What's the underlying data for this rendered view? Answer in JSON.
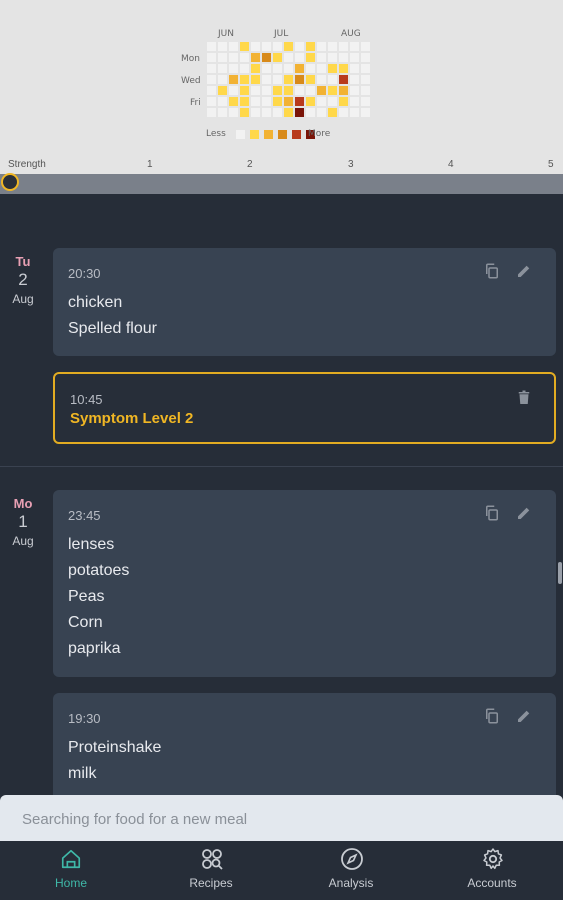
{
  "heatmap": {
    "months": [
      "JUN",
      "JUL",
      "AUG"
    ],
    "days": [
      "Mon",
      "Wed",
      "Fri"
    ],
    "legend_less": "Less",
    "legend_more": "More",
    "colors": {
      "empty": "#f2f2f2",
      "l1": "#ffd84a",
      "l2": "#f2b233",
      "l3": "#d88a1a",
      "l4": "#b83a1c",
      "l5": "#7a1408"
    }
  },
  "strength": {
    "label": "Strength",
    "ticks": [
      "1",
      "2",
      "3",
      "4",
      "5"
    ],
    "value": 0
  },
  "days": [
    {
      "dow": "Tu",
      "num": "2",
      "month": "Aug",
      "meals": [
        {
          "time": "20:30",
          "items": [
            "chicken",
            "Spelled flour"
          ]
        }
      ],
      "symptom": {
        "time": "10:45",
        "title": "Symptom Level 2"
      }
    },
    {
      "dow": "Mo",
      "num": "1",
      "month": "Aug",
      "meals": [
        {
          "time": "23:45",
          "items": [
            "lenses",
            "potatoes",
            "Peas",
            "Corn",
            "paprika"
          ]
        },
        {
          "time": "19:30",
          "items": [
            "Proteinshake",
            "milk"
          ]
        }
      ]
    }
  ],
  "search": {
    "placeholder": "Searching for food for a new meal"
  },
  "nav": [
    {
      "label": "Home",
      "icon": "home-icon",
      "active": true
    },
    {
      "label": "Recipes",
      "icon": "recipes-icon",
      "active": false
    },
    {
      "label": "Analysis",
      "icon": "compass-icon",
      "active": false
    },
    {
      "label": "Accounts",
      "icon": "gear-icon",
      "active": false
    }
  ]
}
